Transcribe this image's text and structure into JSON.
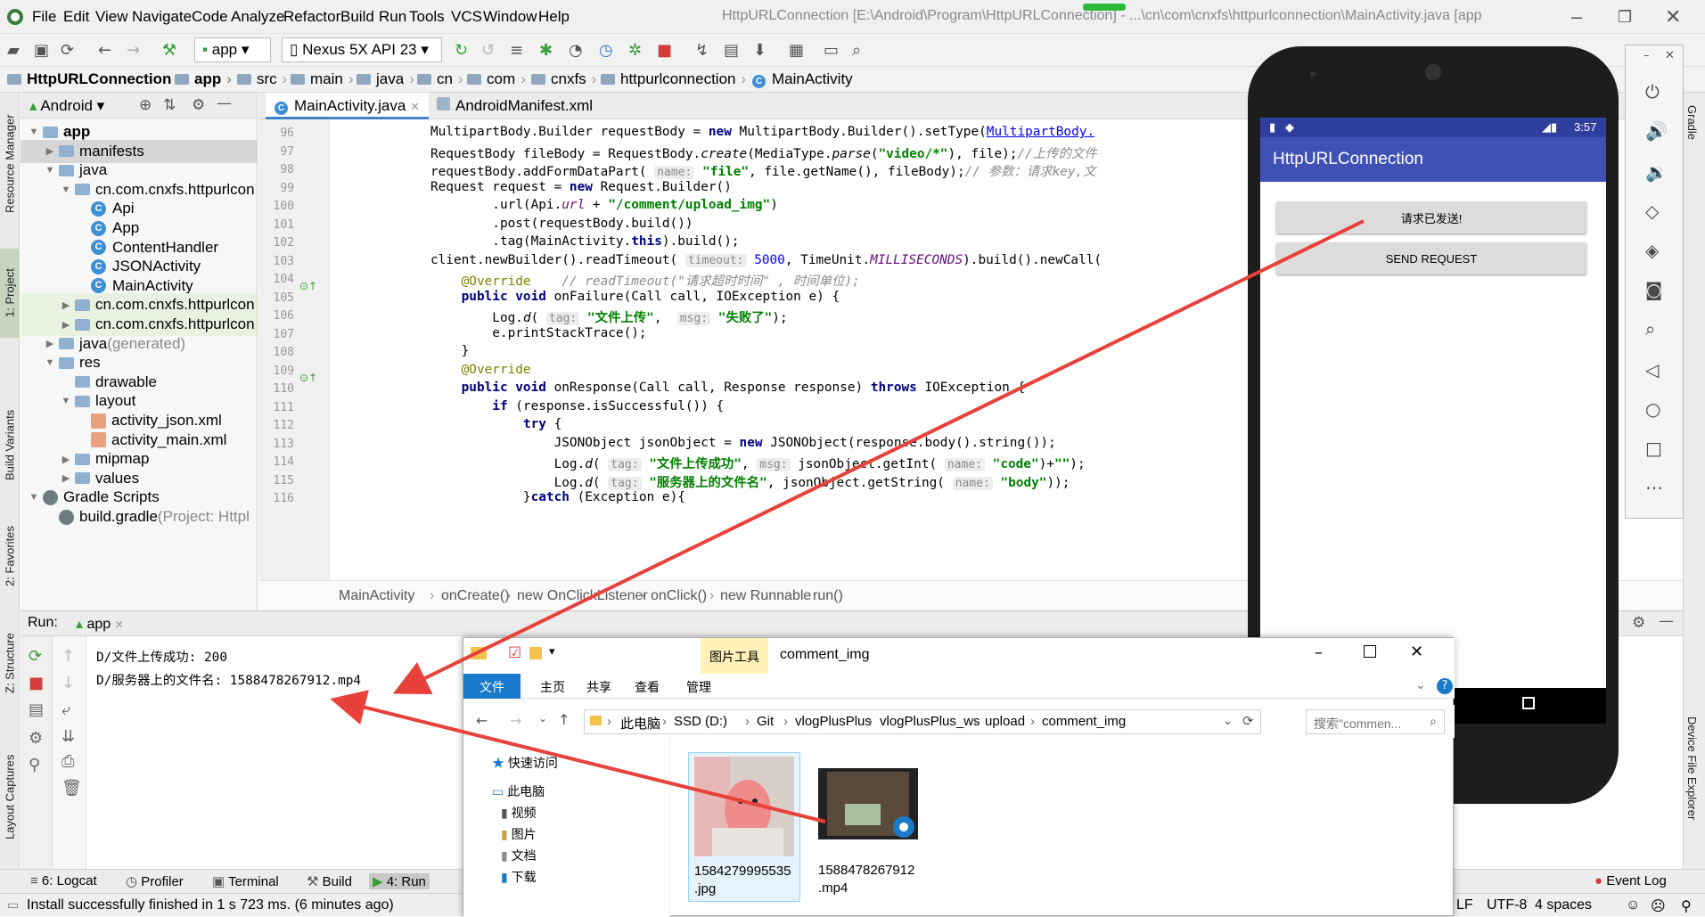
{
  "menu": {
    "items": [
      "File",
      "Edit",
      "View",
      "Navigate",
      "Code",
      "Analyze",
      "Refactor",
      "Build",
      "Run",
      "Tools",
      "VCS",
      "Window",
      "Help"
    ],
    "window_title": "HttpURLConnection [E:\\Android\\Program\\HttpURLConnection] - ...\\cn\\com\\cnxfs\\httpurlconnection\\MainActivity.java [app"
  },
  "toolbar": {
    "module_combo": "app",
    "device_combo": "Nexus 5X API 23"
  },
  "breadcrumbs": [
    "HttpURLConnection",
    "app",
    "src",
    "main",
    "java",
    "cn",
    "com",
    "cnxfs",
    "httpurlconnection",
    "MainActivity"
  ],
  "left_strip": [
    "Resource Manager",
    "1: Project",
    "Build Variants",
    "2: Favorites",
    "Z: Structure",
    "Layout Captures"
  ],
  "right_strip": [
    "Gradle",
    "Device File Explorer"
  ],
  "project": {
    "view_label": "Android",
    "tree": [
      {
        "label": "app",
        "indent": 0,
        "icon": "folder",
        "arrow": "down",
        "bold": true
      },
      {
        "label": "manifests",
        "indent": 1,
        "icon": "folder",
        "arrow": "right"
      },
      {
        "label": "java",
        "indent": 1,
        "icon": "folder",
        "arrow": "down"
      },
      {
        "label": "cn.com.cnxfs.httpurlcon",
        "indent": 2,
        "icon": "folder",
        "arrow": "down"
      },
      {
        "label": "Api",
        "indent": 3,
        "icon": "class"
      },
      {
        "label": "App",
        "indent": 3,
        "icon": "class"
      },
      {
        "label": "ContentHandler",
        "indent": 3,
        "icon": "class"
      },
      {
        "label": "JSONActivity",
        "indent": 3,
        "icon": "class"
      },
      {
        "label": "MainActivity",
        "indent": 3,
        "icon": "class"
      },
      {
        "label": "cn.com.cnxfs.httpurlcon",
        "indent": 2,
        "icon": "folder",
        "arrow": "right"
      },
      {
        "label": "cn.com.cnxfs.httpurlcon",
        "indent": 2,
        "icon": "folder",
        "arrow": "right"
      },
      {
        "label": "java",
        "suffix": " (generated)",
        "indent": 1,
        "icon": "folder",
        "arrow": "right"
      },
      {
        "label": "res",
        "indent": 1,
        "icon": "folder",
        "arrow": "down"
      },
      {
        "label": "drawable",
        "indent": 2,
        "icon": "folder"
      },
      {
        "label": "layout",
        "indent": 2,
        "icon": "folder",
        "arrow": "down"
      },
      {
        "label": "activity_json.xml",
        "indent": 3,
        "icon": "xml"
      },
      {
        "label": "activity_main.xml",
        "indent": 3,
        "icon": "xml"
      },
      {
        "label": "mipmap",
        "indent": 2,
        "icon": "folder",
        "arrow": "right"
      },
      {
        "label": "values",
        "indent": 2,
        "icon": "folder",
        "arrow": "right"
      },
      {
        "label": "Gradle Scripts",
        "indent": 0,
        "icon": "gradle",
        "arrow": "down"
      },
      {
        "label": "build.gradle",
        "suffix": " (Project: Httpl",
        "indent": 1,
        "icon": "gradle"
      }
    ]
  },
  "editor": {
    "tabs": [
      "MainActivity.java",
      "AndroidManifest.xml"
    ],
    "line_numbers": [
      "96",
      "97",
      "98",
      "99",
      "100",
      "101",
      "102",
      "103",
      "104",
      "105",
      "106",
      "107",
      "108",
      "109",
      "110",
      "111",
      "112",
      "113",
      "114",
      "115",
      "116"
    ],
    "breadcrumb": [
      "MainActivity",
      "onCreate()",
      "new OnClickListener",
      "onClick()",
      "new Runnable",
      "run()"
    ],
    "code": [
      {
        "t": "            MultipartBody.Builder requestBody = "
      },
      {
        "t": "new",
        "c": "kw"
      },
      {
        "t": " MultipartBody.Builder().setType("
      },
      {
        "t": "MultipartBody.",
        "c": "lnk"
      },
      {
        "t": "BR"
      },
      {
        "t": "            RequestBody fileBody = RequestBody."
      },
      {
        "t": "create",
        "c": "it"
      },
      {
        "t": "(MediaType."
      },
      {
        "t": "parse",
        "c": "it"
      },
      {
        "t": "("
      },
      {
        "t": "\"video/*\"",
        "c": "st"
      },
      {
        "t": "), file);"
      },
      {
        "t": "//上传的文件",
        "c": "cm"
      },
      {
        "t": "BR"
      },
      {
        "t": "            requestBody.addFormDataPart( "
      },
      {
        "t": "name:",
        "c": "hint"
      },
      {
        "t": " "
      },
      {
        "t": "\"file\"",
        "c": "st"
      },
      {
        "t": ", file.getName(), fileBody);"
      },
      {
        "t": "// 参数：请求key,文",
        "c": "cm"
      },
      {
        "t": "BR"
      },
      {
        "t": "            Request request = "
      },
      {
        "t": "new",
        "c": "kw"
      },
      {
        "t": " Request.Builder()"
      },
      {
        "t": "BR"
      },
      {
        "t": "                    .url(Api."
      },
      {
        "t": "url",
        "c": "fld"
      },
      {
        "t": " + "
      },
      {
        "t": "\"/comment/upload_img\"",
        "c": "st"
      },
      {
        "t": ")"
      },
      {
        "t": "BR"
      },
      {
        "t": "                    .post(requestBody.build())"
      },
      {
        "t": "BR"
      },
      {
        "t": "                    .tag(MainActivity."
      },
      {
        "t": "this",
        "c": "kw"
      },
      {
        "t": ").build();"
      },
      {
        "t": "BR"
      },
      {
        "t": "            client.newBuilder().readTimeout( "
      },
      {
        "t": "timeout:",
        "c": "hint"
      },
      {
        "t": " "
      },
      {
        "t": "5000",
        "c": "nu"
      },
      {
        "t": ", TimeUnit."
      },
      {
        "t": "MILLISECONDS",
        "c": "fld"
      },
      {
        "t": ").build().newCall("
      },
      {
        "t": "BR"
      },
      {
        "t": "                "
      },
      {
        "t": "@Override",
        "c": "an"
      },
      {
        "t": "    "
      },
      {
        "t": "// readTimeout(\"请求超时时间\" , 时间单位);",
        "c": "cm"
      },
      {
        "t": "BR"
      },
      {
        "t": "                "
      },
      {
        "t": "public void",
        "c": "kw"
      },
      {
        "t": " onFailure(Call call, IOException e) {"
      },
      {
        "t": "BR"
      },
      {
        "t": "                    Log."
      },
      {
        "t": "d",
        "c": "it"
      },
      {
        "t": "( "
      },
      {
        "t": "tag:",
        "c": "hint"
      },
      {
        "t": " "
      },
      {
        "t": "\"文件上传\"",
        "c": "st"
      },
      {
        "t": ",  "
      },
      {
        "t": "msg:",
        "c": "hint"
      },
      {
        "t": " "
      },
      {
        "t": "\"失败了\"",
        "c": "st"
      },
      {
        "t": ");"
      },
      {
        "t": "BR"
      },
      {
        "t": "                    e.printStackTrace();"
      },
      {
        "t": "BR"
      },
      {
        "t": "                }"
      },
      {
        "t": "BR"
      },
      {
        "t": "                "
      },
      {
        "t": "@Override",
        "c": "an"
      },
      {
        "t": "BR"
      },
      {
        "t": "                "
      },
      {
        "t": "public void",
        "c": "kw"
      },
      {
        "t": " onResponse(Call call, Response response) "
      },
      {
        "t": "throws",
        "c": "kw"
      },
      {
        "t": " IOException {"
      },
      {
        "t": "BR"
      },
      {
        "t": "                    "
      },
      {
        "t": "if",
        "c": "kw"
      },
      {
        "t": " (response.isSuccessful()) {"
      },
      {
        "t": "BR"
      },
      {
        "t": "                        "
      },
      {
        "t": "try",
        "c": "kw"
      },
      {
        "t": " {"
      },
      {
        "t": "BR"
      },
      {
        "t": "                            JSONObject jsonObject = "
      },
      {
        "t": "new",
        "c": "kw"
      },
      {
        "t": " JSONObject(response.body().string());"
      },
      {
        "t": "BR"
      },
      {
        "t": "                            Log."
      },
      {
        "t": "d",
        "c": "it"
      },
      {
        "t": "( "
      },
      {
        "t": "tag:",
        "c": "hint"
      },
      {
        "t": " "
      },
      {
        "t": "\"文件上传成功\"",
        "c": "st"
      },
      {
        "t": ", "
      },
      {
        "t": "msg:",
        "c": "hint"
      },
      {
        "t": " jsonObject.getInt( "
      },
      {
        "t": "name:",
        "c": "hint"
      },
      {
        "t": " "
      },
      {
        "t": "\"code\"",
        "c": "st"
      },
      {
        "t": ")+"
      },
      {
        "t": "\"\"",
        "c": "st"
      },
      {
        "t": ");"
      },
      {
        "t": "BR"
      },
      {
        "t": "                            Log."
      },
      {
        "t": "d",
        "c": "it"
      },
      {
        "t": "( "
      },
      {
        "t": "tag:",
        "c": "hint"
      },
      {
        "t": " "
      },
      {
        "t": "\"服务器上的文件名\"",
        "c": "st"
      },
      {
        "t": ", jsonObject.getString( "
      },
      {
        "t": "name:",
        "c": "hint"
      },
      {
        "t": " "
      },
      {
        "t": "\"body\"",
        "c": "st"
      },
      {
        "t": "));"
      },
      {
        "t": "BR"
      },
      {
        "t": "                        }"
      },
      {
        "t": "catch",
        "c": "kw"
      },
      {
        "t": " (Exception e){"
      }
    ]
  },
  "run": {
    "label": "Run:",
    "config": "app",
    "output": [
      "D/文件上传成功: 200",
      "D/服务器上的文件名: 1588478267912.mp4"
    ]
  },
  "bottom_tabs": [
    "6: Logcat",
    "Profiler",
    "Terminal",
    "Build",
    "4: Run",
    "Event Log"
  ],
  "status": {
    "message": "Install successfully finished in 1 s 723 ms. (6 minutes ago)",
    "encoding": "UTF-8",
    "indent": "4 spaces",
    "lf": "LF"
  },
  "phone": {
    "time": "3:57",
    "app_title": "HttpURLConnection",
    "button1": "请求已发送!",
    "button2": "SEND REQUEST"
  },
  "explorer": {
    "title": "comment_img",
    "tool_tab": "图片工具",
    "ribbon": [
      "文件",
      "主页",
      "共享",
      "查看",
      "管理"
    ],
    "path": [
      "此电脑",
      "SSD (D:)",
      "Git",
      "vlogPlusPlus",
      "vlogPlusPlus_ws",
      "upload",
      "comment_img"
    ],
    "search_placeholder": "搜索\"commen...",
    "nav": [
      "快速访问",
      "此电脑",
      "视频",
      "图片",
      "文档",
      "下载"
    ],
    "files": [
      {
        "line1": "1584279995535",
        "line2": ".jpg"
      },
      {
        "line1": "1588478267912",
        "line2": ".mp4"
      }
    ]
  },
  "colors": {
    "accent": "#3f51b5",
    "arrow": "#e8413a",
    "selection": "#d6d6d6",
    "keyword": "#000080",
    "string": "#008000"
  }
}
